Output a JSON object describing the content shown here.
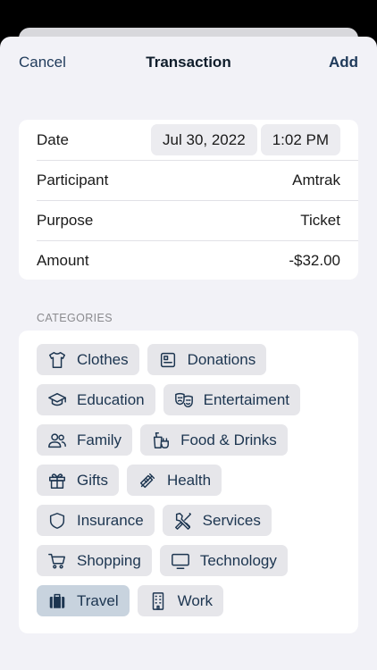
{
  "nav": {
    "cancel": "Cancel",
    "title": "Transaction",
    "add": "Add"
  },
  "form": {
    "date_label": "Date",
    "date_value": "Jul 30, 2022",
    "time_value": "1:02 PM",
    "participant_label": "Participant",
    "participant_value": "Amtrak",
    "purpose_label": "Purpose",
    "purpose_value": "Ticket",
    "amount_label": "Amount",
    "amount_value": "-$32.00"
  },
  "categories": {
    "header": "CATEGORIES",
    "selected": "Travel",
    "items": [
      {
        "label": "Clothes",
        "icon": "tshirt-icon"
      },
      {
        "label": "Donations",
        "icon": "donation-receipt-icon"
      },
      {
        "label": "Education",
        "icon": "graduation-cap-icon"
      },
      {
        "label": "Entertaiment",
        "icon": "theater-masks-icon"
      },
      {
        "label": "Family",
        "icon": "people-icon"
      },
      {
        "label": "Food & Drinks",
        "icon": "food-drinks-icon"
      },
      {
        "label": "Gifts",
        "icon": "gift-icon"
      },
      {
        "label": "Health",
        "icon": "syringe-icon"
      },
      {
        "label": "Insurance",
        "icon": "shield-icon"
      },
      {
        "label": "Services",
        "icon": "tools-icon"
      },
      {
        "label": "Shopping",
        "icon": "cart-icon"
      },
      {
        "label": "Technology",
        "icon": "monitor-icon"
      },
      {
        "label": "Travel",
        "icon": "suitcase-icon"
      },
      {
        "label": "Work",
        "icon": "building-icon"
      }
    ]
  }
}
